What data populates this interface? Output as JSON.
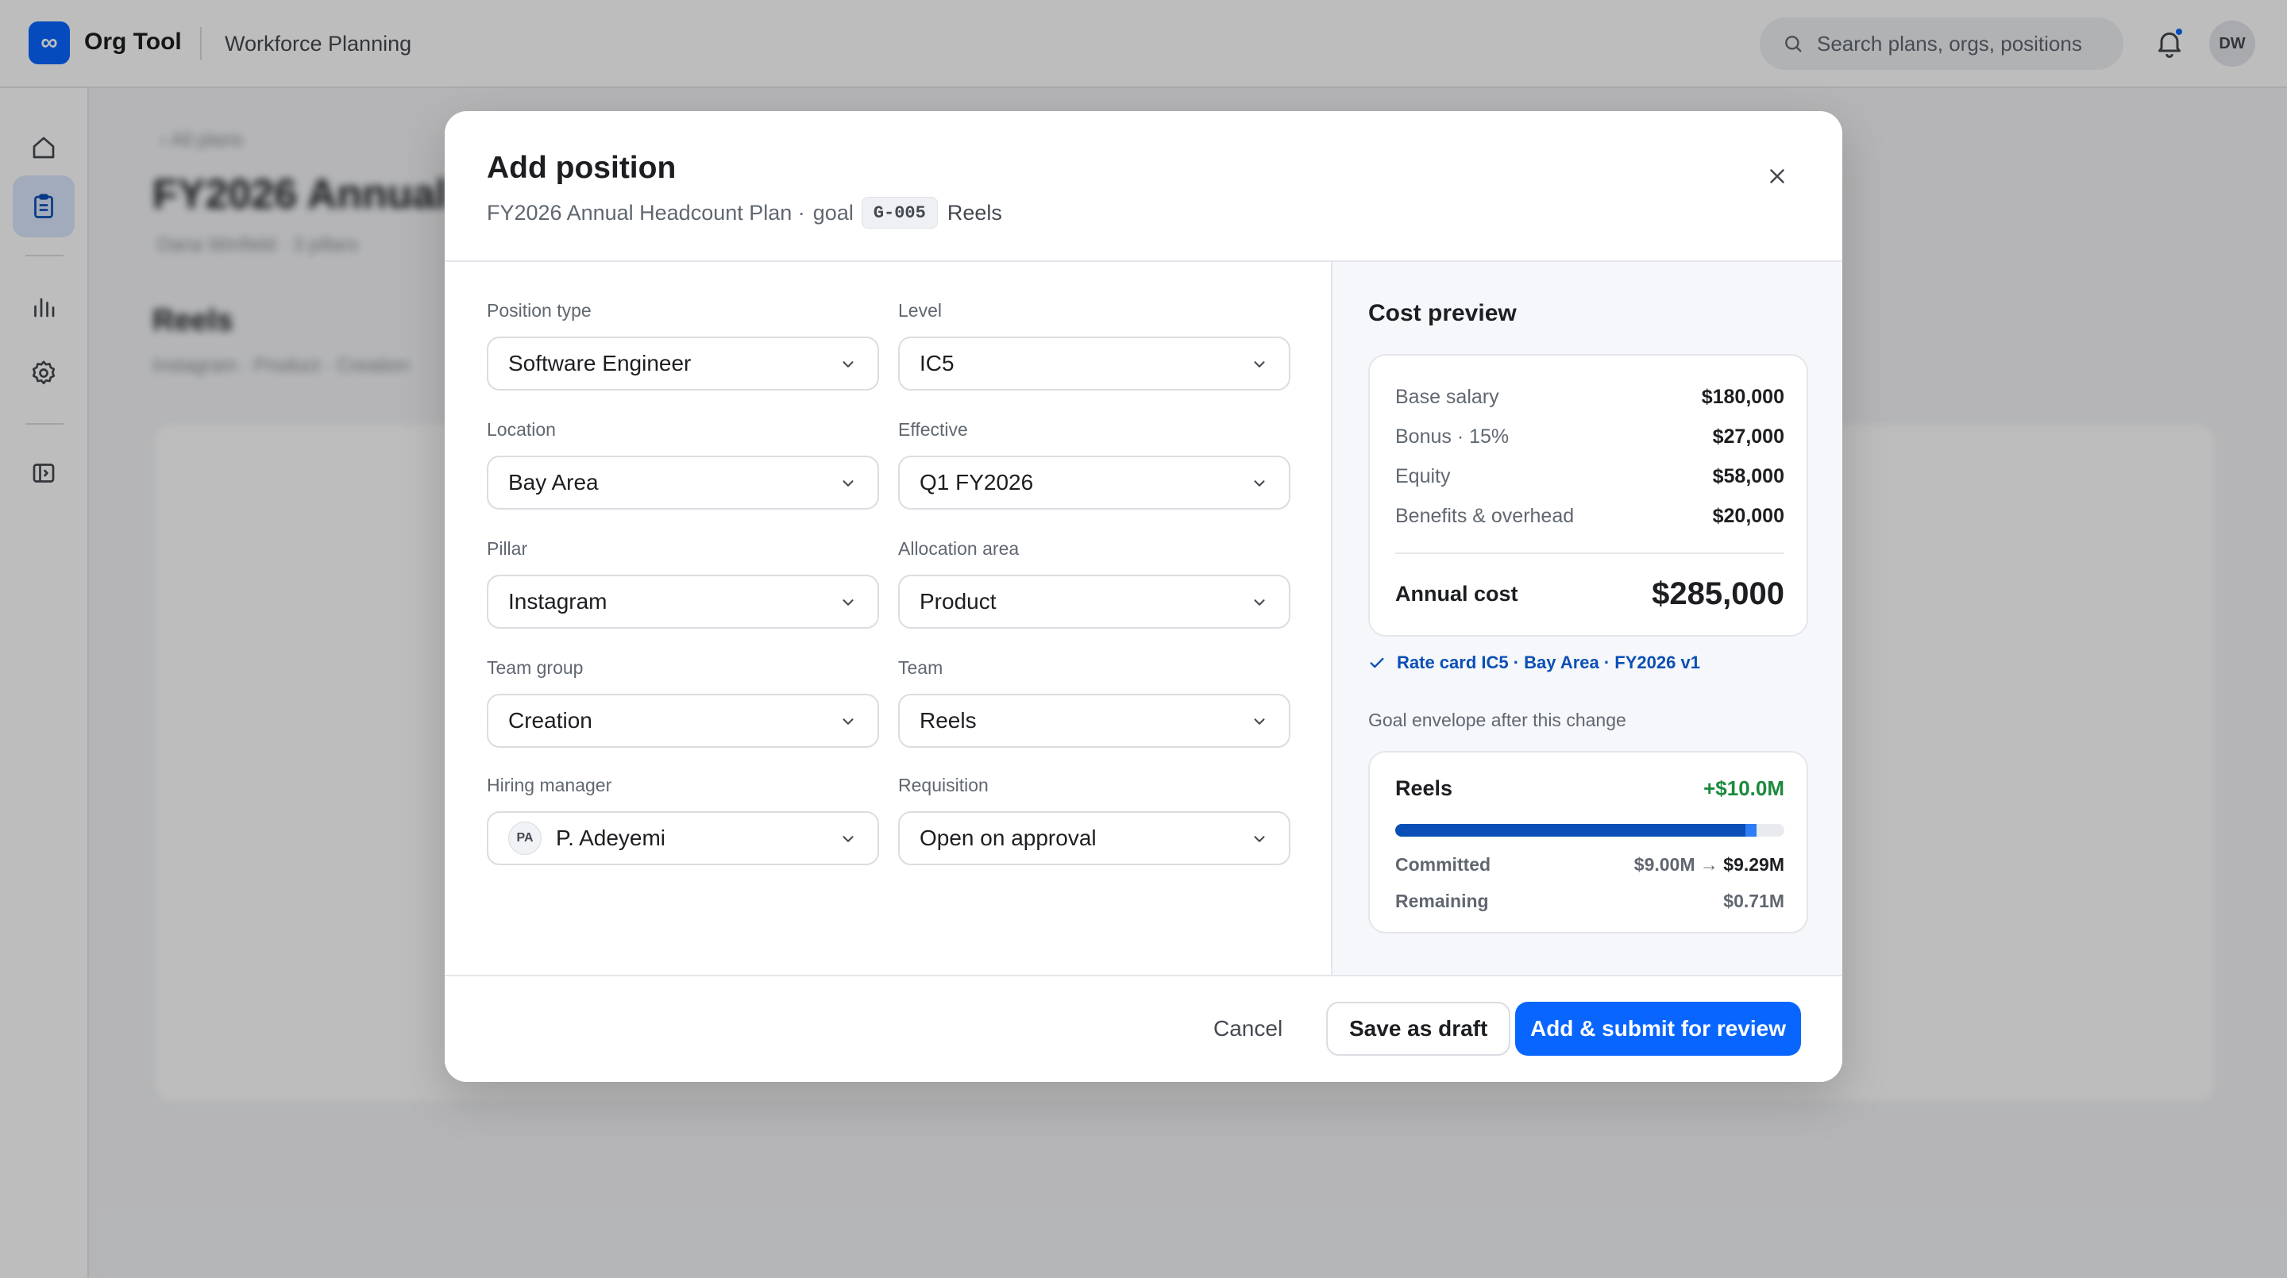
{
  "app": {
    "logo_glyph": "∞",
    "name": "Org Tool",
    "section": "Workforce Planning",
    "brand_color": "#0866ff"
  },
  "search": {
    "placeholder": "Search plans, orgs, positions"
  },
  "user": {
    "initials": "DW"
  },
  "sidebar": {
    "items": [
      {
        "icon": "home-icon",
        "active": false
      },
      {
        "icon": "clipboard-icon",
        "active": true
      },
      {
        "icon": "bar-chart-icon",
        "active": false
      },
      {
        "icon": "gear-icon",
        "active": false
      },
      {
        "icon": "panel-toggle-icon",
        "active": false
      }
    ]
  },
  "background": {
    "crumb": "‹ All plans",
    "title": "FY2026 Annual Headcount Plan",
    "meta": "Dana Winfield · 3 pillars",
    "section_title": "Reels",
    "section_sub": "Instagram · Product · Creation"
  },
  "modal": {
    "title": "Add position",
    "context_plan": "FY2026 Annual Headcount Plan ·",
    "context_goal_word": "goal",
    "goal_id": "G-005",
    "context_team": "Reels",
    "fields": {
      "position_type": {
        "label": "Position type",
        "value": "Software Engineer"
      },
      "level": {
        "label": "Level",
        "value": "IC5"
      },
      "location": {
        "label": "Location",
        "value": "Bay Area"
      },
      "effective": {
        "label": "Effective",
        "value": "Q1 FY2026"
      },
      "pillar": {
        "label": "Pillar",
        "value": "Instagram"
      },
      "allocation_area": {
        "label": "Allocation area",
        "value": "Product"
      },
      "team_group": {
        "label": "Team group",
        "value": "Creation"
      },
      "team": {
        "label": "Team",
        "value": "Reels"
      },
      "hiring_manager": {
        "label": "Hiring manager",
        "value": "P. Adeyemi",
        "initials": "PA"
      },
      "requisition": {
        "label": "Requisition",
        "value": "Open on approval"
      }
    },
    "cost_preview": {
      "title": "Cost preview",
      "rows": [
        {
          "label": "Base salary",
          "amount": "$180,000"
        },
        {
          "label": "Bonus · 15%",
          "amount": "$27,000"
        },
        {
          "label": "Equity",
          "amount": "$58,000"
        },
        {
          "label": "Benefits & overhead",
          "amount": "$20,000"
        }
      ],
      "total_label": "Annual cost",
      "total_amount": "$285,000",
      "rate_card": "Rate card IC5 · Bay Area · FY2026 v1"
    },
    "envelope": {
      "label": "Goal envelope after this change",
      "name": "Reels",
      "delta": "+$10.0M",
      "committed_fraction_before": 0.9,
      "committed_fraction_after": 0.929,
      "committed_label": "Committed",
      "committed_before": "$9.00M",
      "arrow": "→",
      "committed_after": "$9.29M",
      "remaining_label": "Remaining",
      "remaining": "$0.71M"
    },
    "footer": {
      "cancel": "Cancel",
      "save_draft": "Save as draft",
      "submit": "Add & submit for review"
    }
  }
}
